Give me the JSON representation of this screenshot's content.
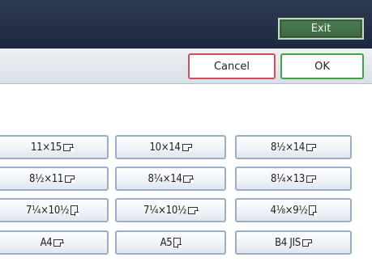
{
  "header": {
    "exit_label": "Exit"
  },
  "actions": {
    "cancel_label": "Cancel",
    "ok_label": "OK"
  },
  "sizes": [
    {
      "label": "11×15",
      "orientation": "landscape"
    },
    {
      "label": "10×14",
      "orientation": "landscape"
    },
    {
      "label": "8½×14",
      "orientation": "landscape"
    },
    {
      "label": "8½×11",
      "orientation": "landscape"
    },
    {
      "label": "8¼×14",
      "orientation": "landscape"
    },
    {
      "label": "8¼×13",
      "orientation": "landscape"
    },
    {
      "label": "7¼×10½",
      "orientation": "portrait"
    },
    {
      "label": "7¼×10½",
      "orientation": "landscape"
    },
    {
      "label": "4⅛×9½",
      "orientation": "portrait"
    },
    {
      "label": "A4",
      "orientation": "landscape"
    },
    {
      "label": "A5",
      "orientation": "portrait"
    },
    {
      "label": "B4 JIS",
      "orientation": "landscape"
    }
  ]
}
